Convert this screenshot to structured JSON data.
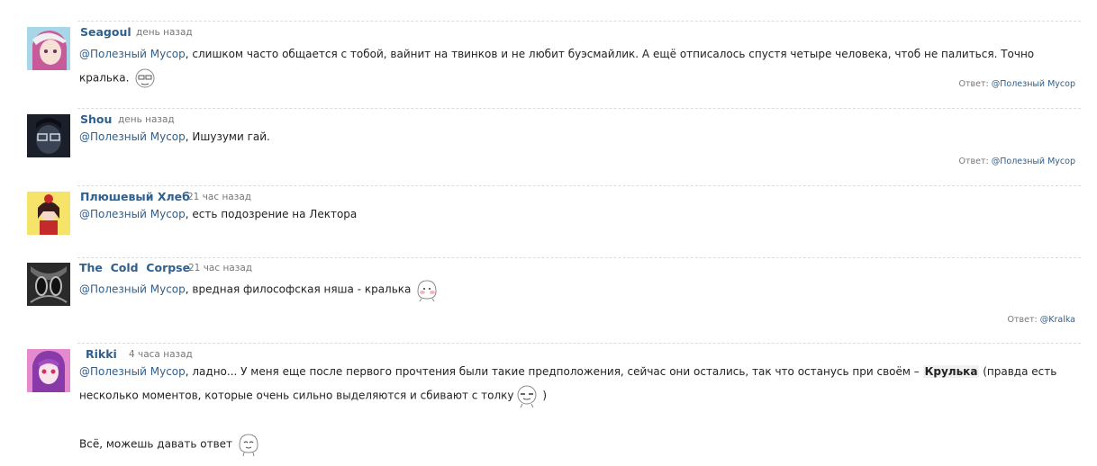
{
  "comments": [
    {
      "author": "Seagoul",
      "time": "день назад",
      "mention": "@Полезный Мусор",
      "text": ", слишком часто общается с тобой, вайнит на твинков и не любит буэсмайлик. А ещё отписалось спустя четыре человека, чтоб не палиться. Точно кралька.",
      "reply_label": "Ответ:",
      "reply_to": "@Полезный Мусор"
    },
    {
      "author": "Shou",
      "time": "день назад",
      "mention": "@Полезный Мусор",
      "text": ", Ишузуми гай.",
      "reply_label": "Ответ:",
      "reply_to": "@Полезный Мусор"
    },
    {
      "author": "Плюшевый Хлеб",
      "time": "21 час назад",
      "mention": "@Полезный Мусор",
      "text": ", есть подозрение на Лектора"
    },
    {
      "author": "The  Cold  Corpse",
      "time": "21 час назад",
      "mention": "@Полезный Мусор",
      "text": ", вредная философская няша - кралька",
      "reply_label": "Ответ:",
      "reply_to": "@Kralka"
    },
    {
      "author": "Rikki",
      "time": "4 часа назад",
      "mention": "@Полезный Мусор",
      "text_part1": ", ладно... У меня еще после первого прочтения были такие предположения, сейчас они остались, так что останусь при своём –",
      "bold": "Крулька",
      "text_part2": " (правда есть несколько моментов, которые очень сильно выделяются и сбивают с толку",
      "text_part3": " )",
      "text_line3": "Всё, можешь давать ответ"
    }
  ],
  "icons": {
    "smile": "smiley-face-icon",
    "avatar": "user-avatar-icon"
  },
  "colors": {
    "link": "#2f5f8c",
    "meta": "#777777",
    "separator": "#dcdcdc"
  }
}
